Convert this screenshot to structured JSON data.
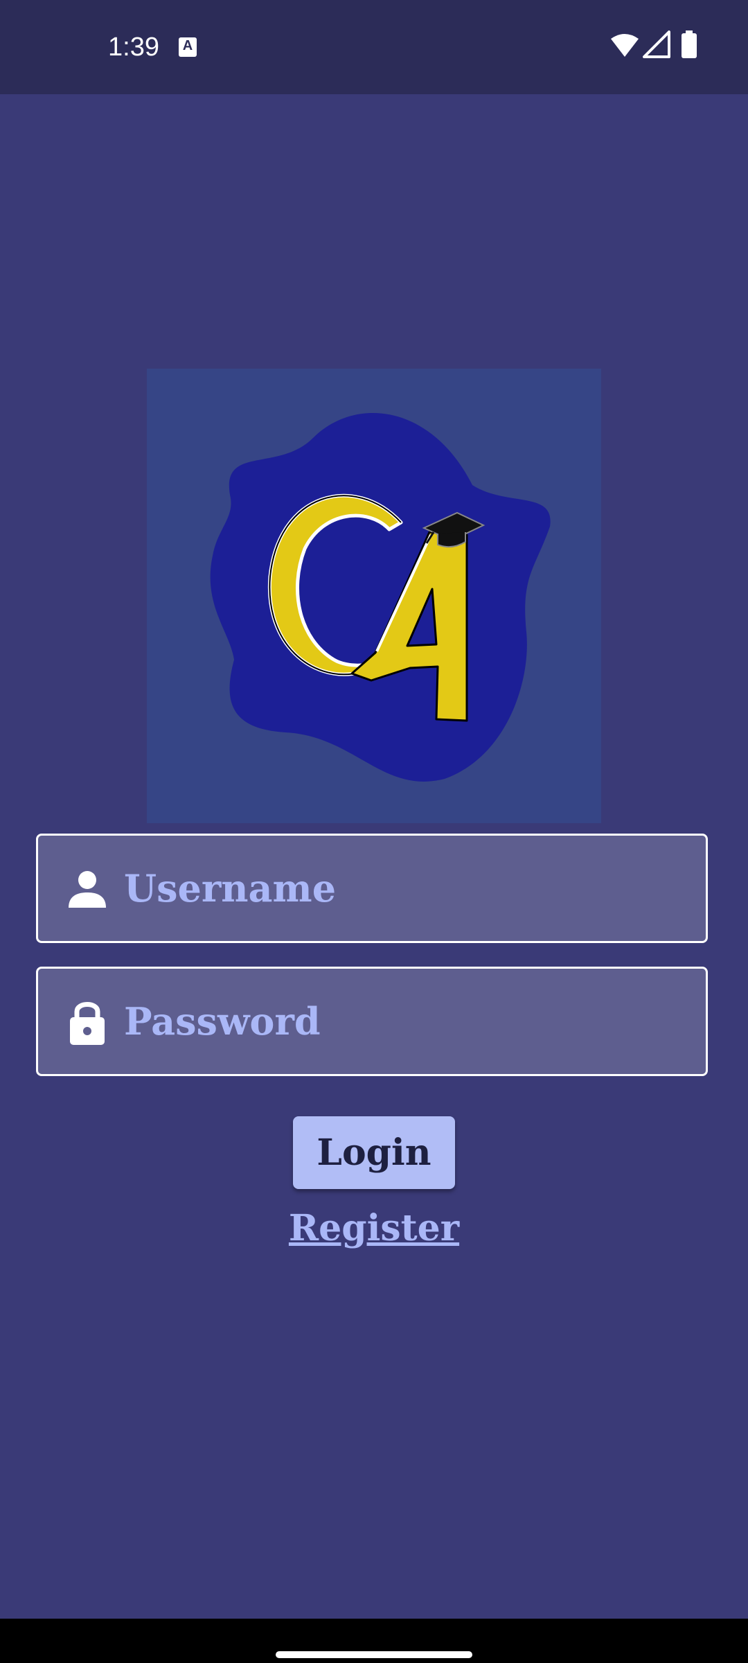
{
  "status_bar": {
    "time": "1:39",
    "notification_letter": "A",
    "icons": [
      "wifi-icon",
      "cell-signal-icon",
      "battery-icon"
    ]
  },
  "logo": {
    "lettering": "CA",
    "icon": "graduation-cap-icon",
    "colors": {
      "frame": "#364586",
      "blob": "#1c1f96",
      "letters": "#e3c916"
    }
  },
  "login_form": {
    "username": {
      "value": "",
      "placeholder": "Username",
      "icon": "person-icon"
    },
    "password": {
      "value": "",
      "placeholder": "Password",
      "icon": "lock-icon"
    },
    "login_label": "Login",
    "register_label": "Register"
  },
  "colors": {
    "background": "#3a3a77",
    "field_background": "#5e5e8f",
    "accent": "#b1bdf6",
    "link": "#aab7f7"
  }
}
